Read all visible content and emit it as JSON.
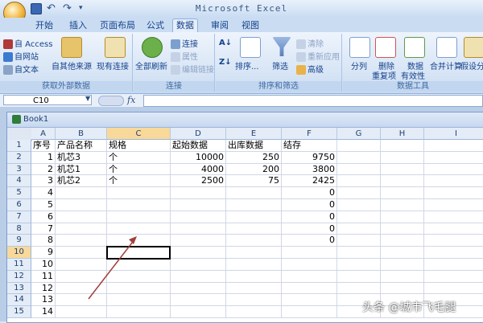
{
  "app": {
    "title": "Microsoft Excel"
  },
  "tabs": [
    {
      "label": "开始"
    },
    {
      "label": "插入"
    },
    {
      "label": "页面布局"
    },
    {
      "label": "公式"
    },
    {
      "label": "数据"
    },
    {
      "label": "审阅"
    },
    {
      "label": "视图"
    }
  ],
  "ribbon": {
    "external": {
      "access": "自 Access",
      "web": "自网站",
      "text": "自文本",
      "other": "自其他来源",
      "existing": "现有连接",
      "label": "获取外部数据"
    },
    "connections": {
      "refresh": "全部刷新",
      "connect": "连接",
      "props": "属性",
      "edit": "编辑链接",
      "label": "连接"
    },
    "sort": {
      "sort": "排序...",
      "filter": "筛选",
      "clear": "清除",
      "reapply": "重新应用",
      "advanced": "高级",
      "label": "排序和筛选"
    },
    "tools": {
      "split": "分列",
      "dedupe1": "删除",
      "dedupe2": "重复项",
      "valid1": "数据",
      "valid2": "有效性",
      "consolidate": "合并计算",
      "whatif": "假设分",
      "label": "数据工具"
    }
  },
  "formula": {
    "cell_ref": "C10",
    "fx": "fx",
    "value": ""
  },
  "workbook": {
    "title": "Book1"
  },
  "columns": [
    "A",
    "B",
    "C",
    "D",
    "E",
    "F",
    "G",
    "H",
    "I"
  ],
  "rows": [
    [
      "序号",
      "产品名称",
      "规格",
      "起始数据",
      "出库数据",
      "结存"
    ],
    [
      "1",
      "机芯3",
      "个",
      "10000",
      "250",
      "9750"
    ],
    [
      "2",
      "机芯1",
      "个",
      "4000",
      "200",
      "3800"
    ],
    [
      "3",
      "机芯2",
      "个",
      "2500",
      "75",
      "2425"
    ],
    [
      "4",
      "",
      "",
      "",
      "",
      "0"
    ],
    [
      "5",
      "",
      "",
      "",
      "",
      "0"
    ],
    [
      "6",
      "",
      "",
      "",
      "",
      "0"
    ],
    [
      "7",
      "",
      "",
      "",
      "",
      "0"
    ],
    [
      "8",
      "",
      "",
      "",
      "",
      "0"
    ],
    [
      "9",
      "",
      "",
      "",
      "",
      ""
    ],
    [
      "10",
      "",
      "",
      "",
      "",
      ""
    ],
    [
      "11",
      "",
      "",
      "",
      "",
      ""
    ],
    [
      "12",
      "",
      "",
      "",
      "",
      ""
    ],
    [
      "13",
      "",
      "",
      "",
      "",
      ""
    ],
    [
      "14",
      "",
      "",
      "",
      "",
      ""
    ]
  ],
  "row_numbers": [
    "1",
    "2",
    "3",
    "4",
    "5",
    "6",
    "7",
    "8",
    "9",
    "10",
    "11",
    "12",
    "13",
    "14",
    "15"
  ],
  "selected": {
    "col": "C",
    "row": "10"
  },
  "watermark": "头条 @城市飞毛腿"
}
